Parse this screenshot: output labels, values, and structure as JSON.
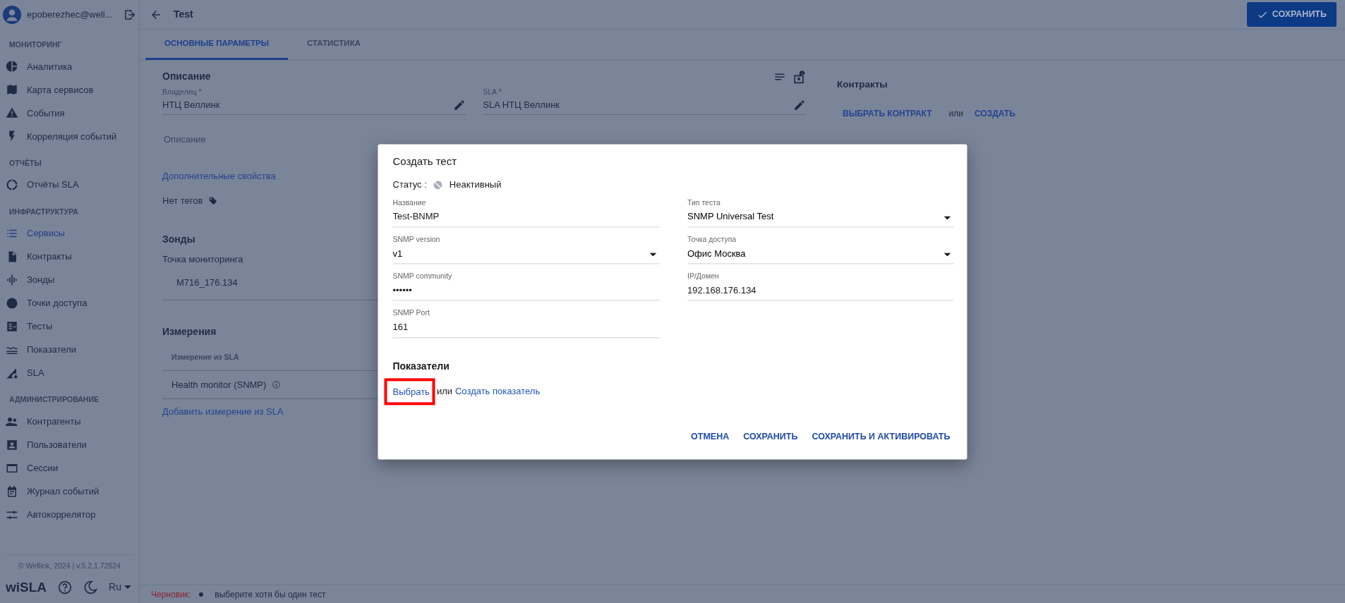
{
  "sidebar": {
    "user": "epoberezhec@well...",
    "sections": [
      {
        "title": "МОНИТОРИНГ",
        "items": [
          {
            "label": "Аналитика",
            "selected": false
          },
          {
            "label": "Карта сервисов",
            "selected": false
          },
          {
            "label": "События",
            "selected": false
          },
          {
            "label": "Корреляция событий",
            "selected": false
          }
        ]
      },
      {
        "title": "ОТЧЁТЫ",
        "items": [
          {
            "label": "Отчёты SLA",
            "selected": false
          }
        ]
      },
      {
        "title": "ИНФРАСТРУКТУРА",
        "items": [
          {
            "label": "Сервисы",
            "selected": true
          },
          {
            "label": "Контракты",
            "selected": false
          },
          {
            "label": "Зонды",
            "selected": false
          },
          {
            "label": "Точки доступа",
            "selected": false
          },
          {
            "label": "Тесты",
            "selected": false
          },
          {
            "label": "Показатели",
            "selected": false
          },
          {
            "label": "SLA",
            "selected": false
          }
        ]
      },
      {
        "title": "АДМИНИСТРИРОВАНИЕ",
        "items": [
          {
            "label": "Контрагенты",
            "selected": false
          },
          {
            "label": "Пользователи",
            "selected": false
          },
          {
            "label": "Сессии",
            "selected": false
          },
          {
            "label": "Журнал событий",
            "selected": false
          },
          {
            "label": "Автокоррелятор",
            "selected": false
          }
        ]
      }
    ],
    "copyright": "© Wellink, 2024 | v.5.2.1.72624",
    "logo": "wiSLA",
    "language": "Ru"
  },
  "header": {
    "title": "Test",
    "save_button": "СОХРАНИТЬ"
  },
  "tabs": [
    {
      "label": "ОСНОВНЫЕ ПАРАМЕТРЫ",
      "selected": true
    },
    {
      "label": "СТАТИСТИКА",
      "selected": false
    }
  ],
  "description": {
    "title": "Описание",
    "fields": [
      {
        "label": "Владелец *",
        "value": "НТЦ Веллинк"
      },
      {
        "label": "SLA *",
        "value": "SLA НТЦ Веллинк"
      }
    ],
    "placeholder": "Описание",
    "more_link": "Дополнительные свойства",
    "tags": "Нет тегов"
  },
  "probes": {
    "title": "Зонды",
    "subtitle": "Точка мониторинга",
    "value": "M716_176.134"
  },
  "measurements": {
    "title": "Измерения",
    "column": "Измерение из SLA",
    "rows": [
      "Health monitor (SNMP)"
    ],
    "add_link": "Добавить измерение из SLA"
  },
  "contracts": {
    "title": "Контракты",
    "choose": "ВЫБРАТЬ КОНТРАКТ",
    "or": "или",
    "create": "СОЗДАТЬ"
  },
  "status_bar": {
    "label": "Черновик:",
    "items": [
      "выберите хотя бы один тест"
    ]
  },
  "modal": {
    "title": "Создать тест",
    "status_label": "Статус :",
    "status": "Неактивный",
    "fields": [
      {
        "kind": "text",
        "label": "Название",
        "value": "Test-BNMP"
      },
      {
        "kind": "select",
        "label": "Тип теста",
        "value": "SNMP Universal Test"
      },
      {
        "kind": "select",
        "label": "SNMP version",
        "value": "v1"
      },
      {
        "kind": "select",
        "label": "Точка доступа",
        "value": "Офис Москва"
      },
      {
        "kind": "text",
        "label": "SNMP community",
        "value": "••••••"
      },
      {
        "kind": "text",
        "label": "IP/Домен",
        "value": "192.168.176.134"
      },
      {
        "kind": "text",
        "label": "SNMP Port",
        "value": "161"
      }
    ],
    "metrics": {
      "title": "Показатели",
      "select": "Выбрать",
      "highlighted": true,
      "or": "или",
      "create": "Создать показатель"
    },
    "buttons": [
      "ОТМЕНА",
      "СОХРАНИТЬ",
      "СОХРАНИТЬ И АКТИВИРОВАТЬ"
    ]
  }
}
